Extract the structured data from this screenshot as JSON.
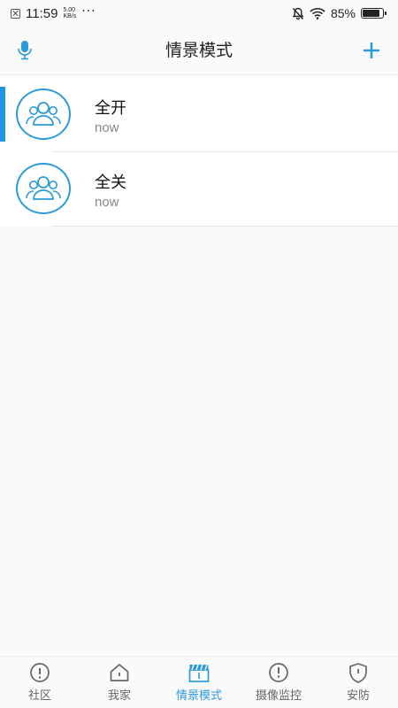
{
  "status_bar": {
    "time": "11:59",
    "speed_value": "5.00",
    "speed_unit": "KB/s",
    "dots": "···",
    "battery_pct": "85%"
  },
  "header": {
    "title": "情景模式",
    "left_icon": "microphone-icon",
    "right_icon": "plus-icon"
  },
  "scenes": [
    {
      "title": "全开",
      "subtitle": "now",
      "icon": "group-icon"
    },
    {
      "title": "全关",
      "subtitle": "now",
      "icon": "group-icon"
    }
  ],
  "bottom_nav": {
    "items": [
      {
        "label": "社区",
        "icon": "info-circle-icon"
      },
      {
        "label": "我家",
        "icon": "home-icon"
      },
      {
        "label": "情景模式",
        "icon": "clapperboard-icon"
      },
      {
        "label": "摄像监控",
        "icon": "camera-alert-icon"
      },
      {
        "label": "安防",
        "icon": "shield-icon"
      }
    ],
    "active_index": 2
  },
  "colors": {
    "accent": "#2a9bd8",
    "selected_bar": "#2196e0",
    "text_primary": "#111111",
    "text_secondary": "#888888",
    "background": "#fafafa"
  }
}
